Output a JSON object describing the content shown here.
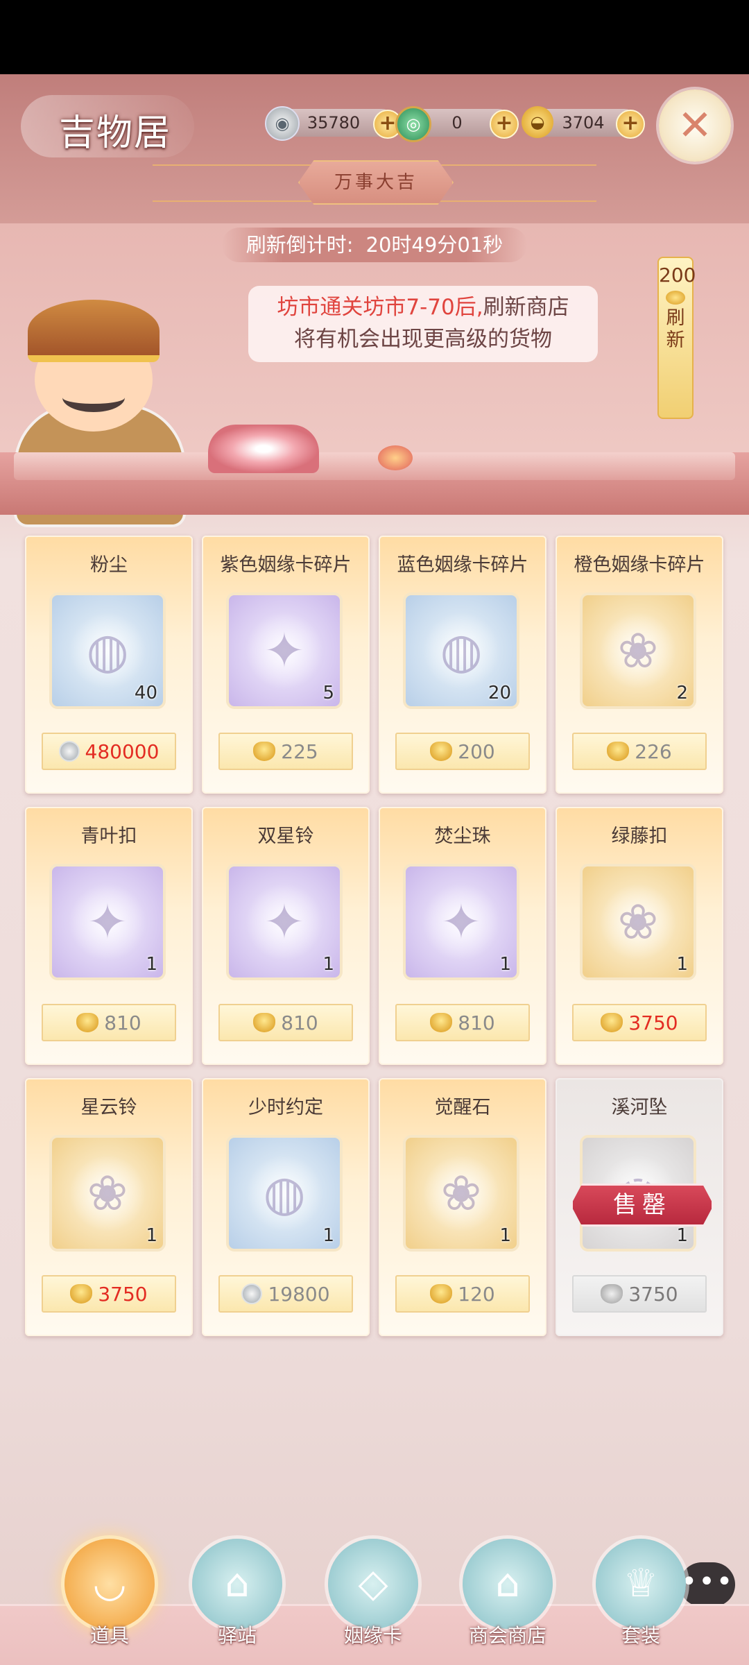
{
  "header": {
    "title": "吉物居",
    "currencies": [
      {
        "icon": "silver-coin-icon",
        "value": "35780"
      },
      {
        "icon": "jade-coin-icon",
        "value": "0"
      },
      {
        "icon": "gold-ingot-icon",
        "value": "3704"
      }
    ],
    "plus_label": "+",
    "close_icon": "close-icon",
    "banner": "万事大吉"
  },
  "shop": {
    "timer_label": "刷新倒计时:",
    "timer_value": "20时49分01秒",
    "notice_line1_pre": "坊市通关坊市7-70后,",
    "notice_line1_post": "刷新商店",
    "notice_line2": "将有机会出现更高级的货物",
    "refresh_cost": "200",
    "refresh_label_1": "刷",
    "refresh_label_2": "新"
  },
  "items": [
    {
      "name": "粉尘",
      "count": "40",
      "price": "480000",
      "currency": "silver-coin-icon",
      "price_color": "red",
      "quality": "blue"
    },
    {
      "name": "紫色姻缘卡碎片",
      "count": "5",
      "price": "225",
      "currency": "gold-ingot-icon",
      "price_color": "grey",
      "quality": "purple"
    },
    {
      "name": "蓝色姻缘卡碎片",
      "count": "20",
      "price": "200",
      "currency": "gold-ingot-icon",
      "price_color": "grey",
      "quality": "blue"
    },
    {
      "name": "橙色姻缘卡碎片",
      "count": "2",
      "price": "226",
      "currency": "gold-ingot-icon",
      "price_color": "grey",
      "quality": "orange"
    },
    {
      "name": "青叶扣",
      "count": "1",
      "price": "810",
      "currency": "gold-ingot-icon",
      "price_color": "grey",
      "quality": "purple"
    },
    {
      "name": "双星铃",
      "count": "1",
      "price": "810",
      "currency": "gold-ingot-icon",
      "price_color": "grey",
      "quality": "purple"
    },
    {
      "name": "焚尘珠",
      "count": "1",
      "price": "810",
      "currency": "gold-ingot-icon",
      "price_color": "grey",
      "quality": "purple"
    },
    {
      "name": "绿藤扣",
      "count": "1",
      "price": "3750",
      "currency": "gold-ingot-icon",
      "price_color": "red",
      "quality": "orange"
    },
    {
      "name": "星云铃",
      "count": "1",
      "price": "3750",
      "currency": "gold-ingot-icon",
      "price_color": "red",
      "quality": "orange"
    },
    {
      "name": "少时约定",
      "count": "1",
      "price": "19800",
      "currency": "silver-coin-icon",
      "price_color": "grey",
      "quality": "blue"
    },
    {
      "name": "觉醒石",
      "count": "1",
      "price": "120",
      "currency": "gold-ingot-icon",
      "price_color": "grey",
      "quality": "orange"
    },
    {
      "name": "溪河坠",
      "count": "1",
      "price": "3750",
      "currency": "gold-ingot-icon",
      "price_color": "dark",
      "quality": "grey",
      "sold_out": true,
      "sold_label": "售罄"
    }
  ],
  "chat_button": {
    "icon": "chat-bubble-icon",
    "label": "•••"
  },
  "nav": [
    {
      "label": "道具",
      "icon": "bowl-icon",
      "active": true
    },
    {
      "label": "驿站",
      "icon": "station-icon",
      "active": false
    },
    {
      "label": "姻缘卡",
      "icon": "card-icon",
      "active": false
    },
    {
      "label": "商会商店",
      "icon": "shop-icon",
      "active": false
    },
    {
      "label": "套装",
      "icon": "outfit-icon",
      "active": false
    }
  ],
  "colors": {
    "accent_red": "#e32b22",
    "gold": "#e6a938",
    "header_pink": "#c98c88"
  }
}
